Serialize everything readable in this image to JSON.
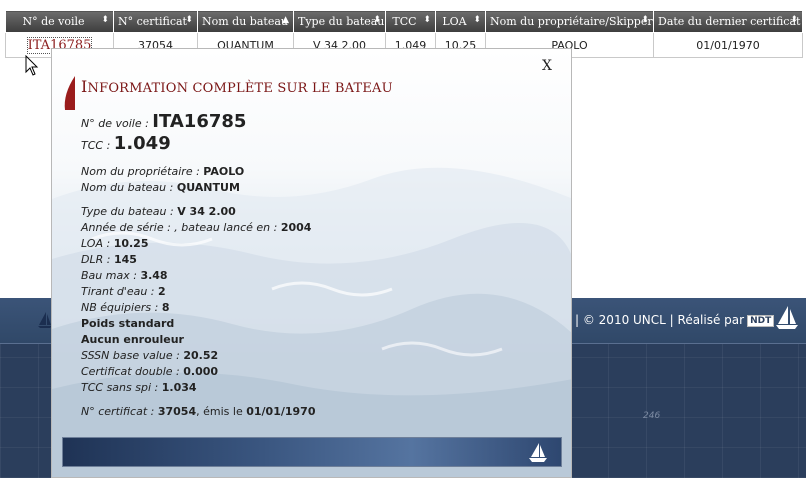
{
  "table": {
    "headers": [
      "N° de voile",
      "N° certificat",
      "Nom du bateau",
      "Type du bateau",
      "TCC",
      "LOA",
      "Nom du propriétaire/Skipper",
      "Date du dernier certificat"
    ],
    "sort_icons": [
      "⬍",
      "⬍",
      "▲",
      "⬍",
      "⬍",
      "⬍",
      "⬍",
      "⬍"
    ],
    "rows": [
      {
        "sail_number": "ITA16785",
        "certificate": "37054",
        "boat_name": "QUANTUM",
        "boat_type": "V 34 2.00",
        "tcc": "1.049",
        "loa": "10.25",
        "owner": "PAOLO",
        "date": "01/01/1970"
      }
    ]
  },
  "footer": {
    "copyright": "| © 2010 UNCL | Réalisé par",
    "logo_text": "NDT",
    "chart_number": "246"
  },
  "modal": {
    "close_label": "X",
    "title_first": "I",
    "title_rest": "NFORMATION COMPLÈTE SUR LE BATEAU",
    "fields": {
      "sail_label": "N° de voile :",
      "sail_value": "ITA16785",
      "tcc_label": "TCC :",
      "tcc_value": "1.049",
      "owner_label": "Nom du propriétaire :",
      "owner_value": "PAOLO",
      "boat_label": "Nom du bateau :",
      "boat_value": "QUANTUM",
      "type_label": "Type du bateau :",
      "type_value": "V 34 2.00",
      "year_label": "Année de série : , bateau lancé en :",
      "year_value": "2004",
      "loa_label": "LOA :",
      "loa_value": "10.25",
      "dlr_label": "DLR :",
      "dlr_value": "145",
      "bau_label": "Bau max :",
      "bau_value": "3.48",
      "tirant_label": "Tirant d'eau :",
      "tirant_value": "2",
      "crew_label": "NB équipiers :",
      "crew_value": "8",
      "weight_text": "Poids standard",
      "furler_text": "Aucun enrouleur",
      "sssn_label": "SSSN base value :",
      "sssn_value": "20.52",
      "double_label": "Certificat double :",
      "double_value": "0.000",
      "spi_label": "TCC sans spi :",
      "spi_value": "1.034",
      "cert_label": "N° certificat :",
      "cert_value": "37054",
      "issued_label": ", émis le",
      "issued_value": "01/01/1970"
    }
  },
  "colors": {
    "header_bg": "#4a4a4a",
    "title_red": "#7a1515",
    "link_red": "#8b1c1c",
    "footer_blue": "#2b3e5c"
  },
  "icons": [
    "sort-icon",
    "sail-icon",
    "cursor-icon",
    "close-icon"
  ]
}
